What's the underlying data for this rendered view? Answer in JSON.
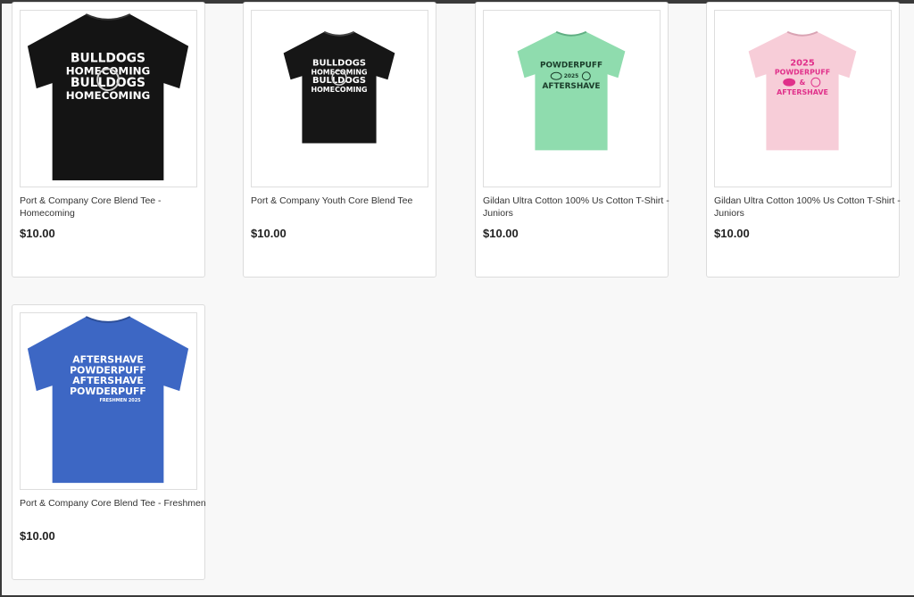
{
  "products": [
    {
      "title": "Port & Company Core Blend Tee - Homecoming",
      "price": "$10.00",
      "shirt_color": "#141414",
      "print_color": "#ffffff",
      "print_lines": [
        "BULLDOGS",
        "HOMECOMING",
        "BULLDOGS",
        "HOMECOMING"
      ]
    },
    {
      "title": "Port & Company Youth Core Blend Tee",
      "price": "$10.00",
      "shirt_color": "#161616",
      "print_color": "#ffffff",
      "print_lines": [
        "BULLDOGS",
        "HOMECOMING",
        "BULLDOGS",
        "HOMECOMING"
      ]
    },
    {
      "title": "Gildan Ultra Cotton 100% Us Cotton T-Shirt - Juniors",
      "price": "$10.00",
      "shirt_color": "#8fdcae",
      "print_color": "#1a3d2a",
      "print_lines": [
        "POWDERPUFF",
        "2025",
        "AFTERSHAVE"
      ]
    },
    {
      "title": "Gildan Ultra Cotton 100% Us Cotton T-Shirt - Juniors",
      "price": "$10.00",
      "shirt_color": "#f7cdd8",
      "print_color": "#e0308a",
      "print_lines": [
        "2025",
        "POWDERPUFF",
        "&",
        "AFTERSHAVE"
      ]
    },
    {
      "title": "Port & Company Core Blend Tee - Freshmen",
      "price": "$10.00",
      "shirt_color": "#3d67c4",
      "print_color": "#ffffff",
      "print_lines": [
        "AFTERSHAVE",
        "POWDERPUFF",
        "AFTERSHAVE",
        "POWDERPUFF",
        "FRESHMEN 2025"
      ]
    }
  ]
}
